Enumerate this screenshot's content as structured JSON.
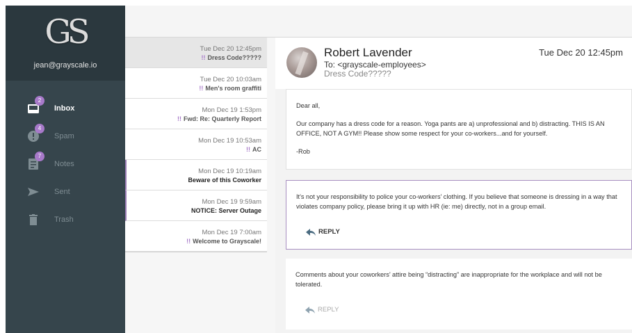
{
  "sidebar": {
    "logo": "GS",
    "user_email": "jean@grayscale.io",
    "items": [
      {
        "label": "Inbox",
        "badge": "2",
        "icon": "inbox-icon"
      },
      {
        "label": "Spam",
        "badge": "4",
        "icon": "alert-icon"
      },
      {
        "label": "Notes",
        "badge": "7",
        "icon": "note-icon"
      },
      {
        "label": "Sent",
        "badge": "",
        "icon": "send-icon"
      },
      {
        "label": "Trash",
        "badge": "",
        "icon": "trash-icon"
      }
    ]
  },
  "messages": [
    {
      "date": "Tue Dec 20 12:45pm",
      "flag": "!!",
      "subject": "Dress Code?????"
    },
    {
      "date": "Tue Dec 20 10:03am",
      "flag": "!!",
      "subject": "Men's room graffiti"
    },
    {
      "date": "Mon Dec 19 1:53pm",
      "flag": "!!",
      "subject": "Fwd: Re: Quarterly Report"
    },
    {
      "date": "Mon Dec 19 10:53am",
      "flag": "!!",
      "subject": "AC"
    },
    {
      "date": "Mon Dec 19 10:19am",
      "flag": "",
      "subject": "Beware of this Coworker"
    },
    {
      "date": "Mon Dec 19 9:59am",
      "flag": "",
      "subject": "NOTICE: Server Outage"
    },
    {
      "date": "Mon Dec 19 7:00am",
      "flag": "!!",
      "subject": "Welcome to Grayscale!"
    }
  ],
  "email": {
    "sender": "Robert Lavender",
    "to": "To: <grayscale-employees>",
    "subject": "Dress Code?????",
    "date": "Tue Dec 20 12:45pm",
    "body": [
      "Dear all,",
      "Our company has a dress code for a reason. Yoga pants are a) unprofessional and b) distracting. THIS IS AN OFFICE, NOT A GYM!! Please show some respect for your co-workers...and for yourself.",
      "-Rob"
    ]
  },
  "replies": [
    {
      "text": "It's not your responsibility to police your co-workers’ clothing. If you believe that someone is dressing in a way that violates company policy, please bring it up with HR (ie: me) directly, not in a group email.",
      "button": "REPLY"
    },
    {
      "text": "Comments about your coworkers’ attire being “distracting” are inappropriate for the workplace and will not be tolerated.",
      "button": "REPLY"
    }
  ],
  "colors": {
    "accent": "#a779c9",
    "sidebar": "#36454c",
    "sidebar_top": "#2b383e"
  }
}
